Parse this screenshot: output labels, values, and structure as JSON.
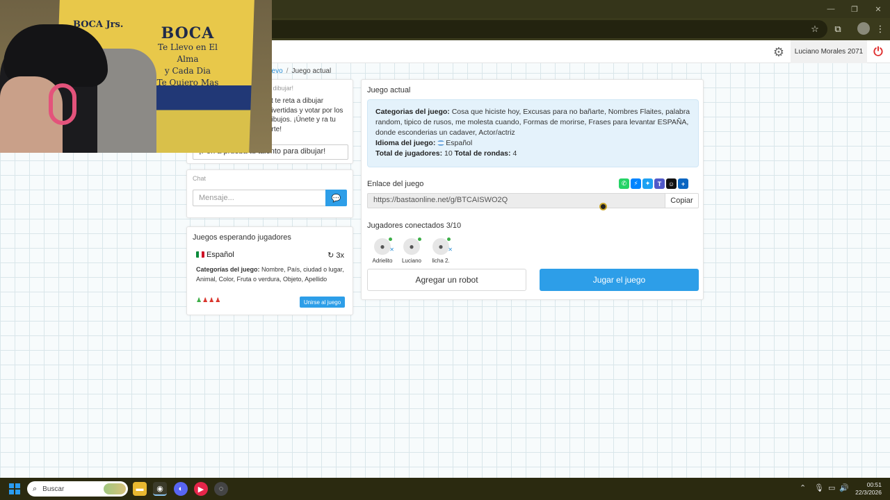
{
  "app_header": {
    "user_name": "Luciano Morales 2071"
  },
  "breadcrumb": {
    "parent": "uevo",
    "current": "Juego actual"
  },
  "promo_card": {
    "heading": "a dibujar!",
    "description": "st te reta a dibujar divertidas y votar por los dibujos. ¡Únete y ra tu arte!",
    "cta": "¡Pon a prueba tu talento para dibujar!"
  },
  "chat": {
    "title": "Chat",
    "placeholder": "Mensaje..."
  },
  "waiting_games": {
    "title": "Juegos esperando jugadores",
    "game": {
      "language": "Español",
      "multiplier": "3x",
      "categories_label": "Categorías del juego:",
      "categories": "Nombre, País, ciudad o lugar, Animal, Color, Fruta o verdura, Objeto, Apellido",
      "players_connected": 1,
      "players_missing": 3,
      "join_label": "Unirse al juego"
    }
  },
  "current_game": {
    "title": "Juego actual",
    "categories_label": "Categorias del juego:",
    "categories": "Cosa que hiciste hoy, Excusas para no bañarte, Nombres Flaites, palabra random, tipico de rusos, me molesta cuando, Formas de morirse, Frases para levantar ESPAÑA, donde esconderias un cadaver, Actor/actriz",
    "language_label": "Idioma del juego:",
    "language": "Español",
    "players_total_label": "Total de jugadores:",
    "players_total": "10",
    "rounds_label": "Total de rondas:",
    "rounds": "4",
    "link_label": "Enlace del juego",
    "link": "https://bastaonline.net/g/BTCAISWO2Q",
    "copy_label": "Copiar",
    "connected_label": "Jugadores conectados 3/10",
    "players": [
      {
        "name": "Adrielito"
      },
      {
        "name": "Luciano"
      },
      {
        "name": "licha 2."
      }
    ],
    "add_robot_label": "Agregar un robot",
    "play_label": "Jugar el juego"
  },
  "webcam": {
    "cloth_small": "BOCA Jrs.",
    "cloth_big": "BOCA",
    "cloth_line1": "Te Llevo en El Alma",
    "cloth_line2": "y Cada Dia",
    "cloth_line3": "Te Quiero Mas"
  },
  "taskbar": {
    "search_placeholder": "Buscar",
    "time": "00:51",
    "date": "22/3/2026"
  },
  "colors": {
    "accent": "#2d9ee8",
    "power": "#e03030",
    "online": "#3cae47",
    "offline": "#d9342b"
  }
}
